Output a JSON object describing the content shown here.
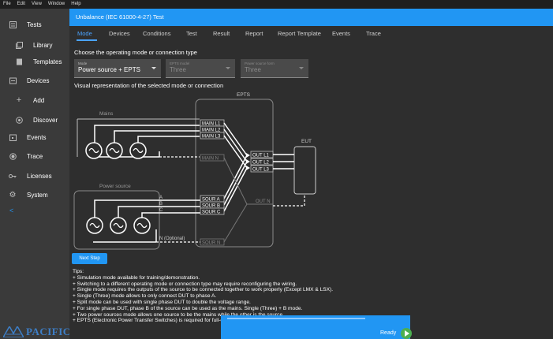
{
  "menu": [
    "File",
    "Edit",
    "View",
    "Window",
    "Help"
  ],
  "sidebar": {
    "items": [
      {
        "label": "Tests",
        "icon": "list-icon"
      },
      {
        "label": "Library",
        "icon": "library-icon"
      },
      {
        "label": "Templates",
        "icon": "template-icon"
      },
      {
        "label": "Devices",
        "icon": "devices-icon"
      },
      {
        "label": "Add",
        "icon": "plus-icon"
      },
      {
        "label": "Discover",
        "icon": "discover-icon"
      },
      {
        "label": "Events",
        "icon": "events-icon"
      },
      {
        "label": "Trace",
        "icon": "trace-icon"
      },
      {
        "label": "Licenses",
        "icon": "key-icon"
      },
      {
        "label": "System",
        "icon": "gear-icon"
      }
    ],
    "collapse_glyph": "<",
    "logo_text": "PACIFIC"
  },
  "title": "Unbalance (IEC 61000-4-27) Test",
  "tabs": [
    "Mode",
    "Devices",
    "Conditions",
    "Test",
    "Result",
    "Report",
    "Report Template",
    "Events",
    "Trace"
  ],
  "mode_heading": "Choose the operating mode or connection type",
  "selects": [
    {
      "caption": "Mode",
      "value": "Power source + EPTS",
      "disabled": false
    },
    {
      "caption": "EPTS model",
      "value": "Three",
      "disabled": true
    },
    {
      "caption": "Power source form",
      "value": "Three",
      "disabled": true
    }
  ],
  "visual_heading": "Visual representation of the selected mode or connection",
  "diagram": {
    "epts_label": "EPTS",
    "eut_label": "EUT",
    "mains_label": "Mains",
    "power_source_label": "Power source",
    "main_lines": [
      "MAIN L1",
      "MAIN L2",
      "MAIN L3",
      "MAIN N"
    ],
    "source_lines": [
      "SOUR A",
      "SOUR B",
      "SOUR C",
      "SOUR N"
    ],
    "phase_letters": [
      "A",
      "B",
      "C"
    ],
    "n_optional": "N (Optional)",
    "out_lines": [
      "OUT L1",
      "OUT L2",
      "OUT L3",
      "OUT N"
    ]
  },
  "next_step": "Next Step",
  "tips": [
    "Tips:",
    "+ Simulation mode available for training/demonstration.",
    "+ Switching to a different operating mode or connection type may require reconfiguring the wiring.",
    "+ Single mode requires the outputs of the source to be connected together to work properly (Except LMX & LSX).",
    "+ Single (Three) mode allows to only connect DUT to phase A.",
    "+ Split mode can be used with single phase DUT to double the voltage range.",
    "+ For single phase DUT, phase B of the source can be used as the mains. Single (Three) + B mode.",
    "+ Two power sources mode allows one source to be the mains while the other is the source.",
    "+ EPTS (Electronic Power Transfer Switches) is required for full-compliance dip/interrupt with transition times lower than 5us."
  ],
  "status": {
    "ready": "Ready"
  }
}
